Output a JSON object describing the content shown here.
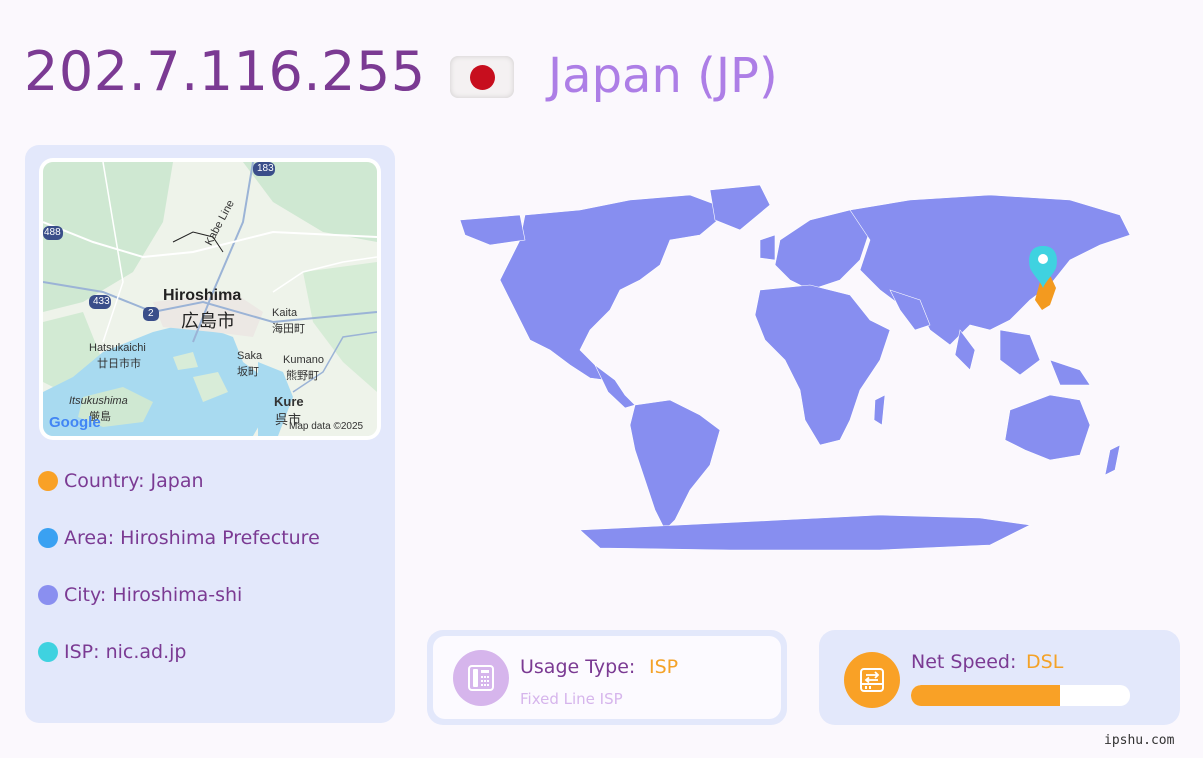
{
  "header": {
    "ip": "202.7.116.255",
    "country": "Japan (JP)",
    "flag_icon": "japan-flag-icon"
  },
  "mini_map": {
    "labels": {
      "r183": "183",
      "r488": "488",
      "r433": "433",
      "r2": "2",
      "kabe_line": "Kabe Line",
      "hiroshima": "Hiroshima",
      "hiroshima_kanji": "広島市",
      "kaita": "Kaita",
      "kaita_kanji": "海田町",
      "hatsukaichi": "Hatsukaichi",
      "hatsukaichi_kanji": "廿日市市",
      "saka": "Saka",
      "saka_kanji": "坂町",
      "kumano": "Kumano",
      "kumano_kanji": "熊野町",
      "itsukushima": "Itsukushima",
      "itsukushima_kanji": "厳島",
      "kure": "Kure",
      "kure_kanji": "呉市"
    },
    "google": "Google",
    "attribution": "Map data ©2025"
  },
  "info": {
    "country": "Country: Japan",
    "area": "Area: Hiroshima Prefecture",
    "city": "City: Hiroshima-shi",
    "isp": "ISP: nic.ad.jp"
  },
  "colors": {
    "country_dot": "#f9a126",
    "area_dot": "#3aa1f2",
    "city_dot": "#8a8ff0",
    "isp_dot": "#3fd2e0",
    "map_land": "#878ef0",
    "marker": "#3fd2e0",
    "highlight": "#f39a1f"
  },
  "usage": {
    "label": "Usage Type:",
    "value": "ISP",
    "sub": "Fixed Line ISP",
    "icon": "phone-icon"
  },
  "speed": {
    "label": "Net Speed:",
    "value": "DSL",
    "level": 0.68,
    "icon": "hard-drive-icon"
  },
  "watermark": "ipshu.com"
}
